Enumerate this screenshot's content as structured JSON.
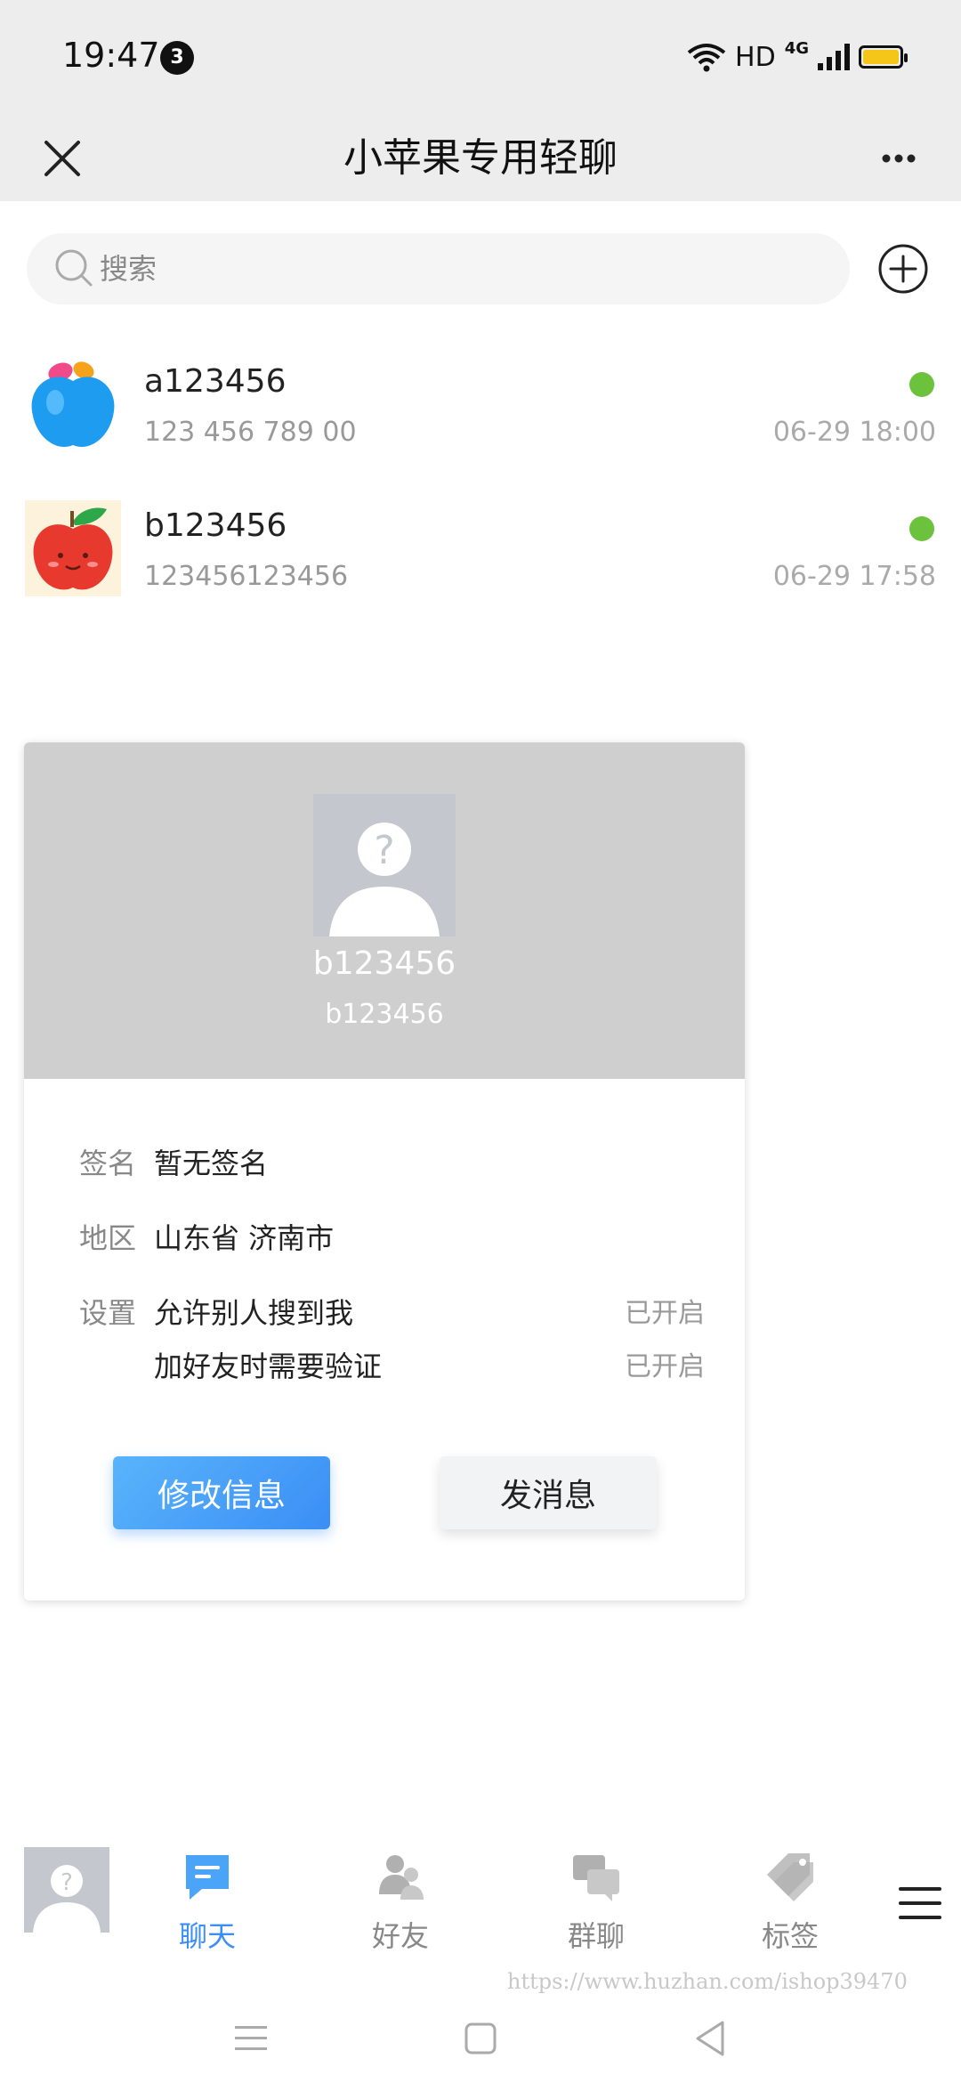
{
  "status_bar": {
    "time": "19:47",
    "notification_count": "3",
    "network": "HD",
    "network_type": "4G"
  },
  "header": {
    "title": "小苹果专用轻聊"
  },
  "search": {
    "placeholder": "搜索"
  },
  "chats": [
    {
      "name": "a123456",
      "preview": "123 456 789 00",
      "time": "06-29 18:00",
      "online": true
    },
    {
      "name": "b123456",
      "preview": "123456123456",
      "time": "06-29 17:58",
      "online": true
    }
  ],
  "profile_card": {
    "name": "b123456",
    "id": "b123456",
    "signature_label": "签名",
    "signature_value": "暂无签名",
    "region_label": "地区",
    "region_value": "山东省 济南市",
    "settings_label": "设置",
    "settings": [
      {
        "name": "允许别人搜到我",
        "state": "已开启"
      },
      {
        "name": "加好友时需要验证",
        "state": "已开启"
      }
    ],
    "edit_button": "修改信息",
    "message_button": "发消息"
  },
  "bottom_nav": {
    "items": [
      {
        "label": "聊天",
        "active": true
      },
      {
        "label": "好友",
        "active": false
      },
      {
        "label": "群聊",
        "active": false
      },
      {
        "label": "标签",
        "active": false
      }
    ]
  },
  "watermark": "https://www.huzhan.com/ishop39470",
  "colors": {
    "accent": "#3a8ef5",
    "online": "#6cc13d",
    "header_bg": "#ededed",
    "card_header_bg": "#cfcfcf"
  }
}
